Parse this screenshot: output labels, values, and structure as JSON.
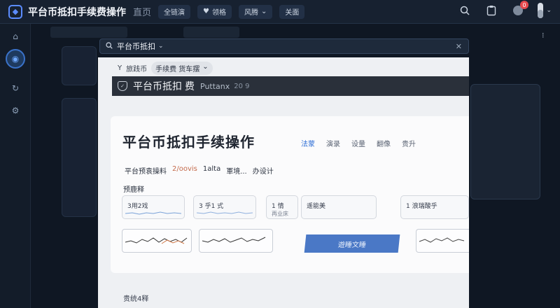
{
  "topbar": {
    "app_title": "平台币抵扣手续费操作",
    "app_sub": "直页",
    "nav": [
      "全链演",
      "领格",
      "风腾",
      "关面"
    ],
    "notification_count": "0"
  },
  "search": {
    "value": "平台币抵扣"
  },
  "panel": {
    "breadcrumb": {
      "root": "旅践币",
      "chip": "手续费 货车摆"
    },
    "header": {
      "title": "平台币抵扣",
      "title_suffix": "费",
      "subtitle": "Puttanx",
      "version": "20 9"
    },
    "card": {
      "title": "平台币抵扣手续操作",
      "tabs": [
        "法蒙",
        "演录",
        "设量",
        "翻像",
        "贵升"
      ],
      "meta": [
        "平台预袁操料",
        "2/oovis",
        "1alta",
        "軍境...",
        "办设计"
      ],
      "section_label": "预鹿释",
      "mini_cards": [
        "3用2戏",
        "3 乎1 式",
        "1 情",
        "遥能美",
        "1 浪瑞酸乎"
      ],
      "mini_subs": [
        "",
        "",
        "再业床",
        "",
        ""
      ],
      "button_label": "遊睡文睡"
    },
    "footer_label": "贵统4释"
  },
  "colors": {
    "accent": "#2f6fd6",
    "button": "#4a78c6",
    "badge": "#e5484d"
  }
}
